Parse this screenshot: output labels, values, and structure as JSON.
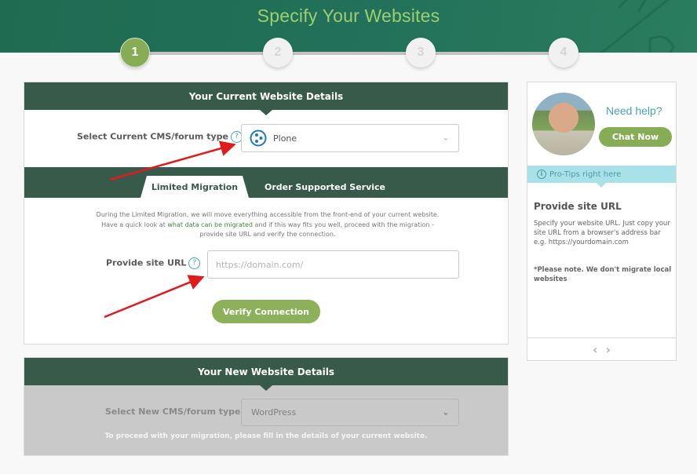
{
  "header": {
    "title": "Specify Your Websites",
    "steps": [
      {
        "label": "1",
        "state": "active"
      },
      {
        "label": "2",
        "state": "inactive"
      },
      {
        "label": "3",
        "state": "inactive"
      },
      {
        "label": "4",
        "state": "inactive"
      }
    ]
  },
  "current": {
    "heading": "Your Current Website Details",
    "cms_label": "Select Current CMS/forum type",
    "help_glyph": "?",
    "cms_value": "Plone",
    "cms_icon": "plone-logo-icon",
    "chevron": "⌄",
    "tabs": [
      {
        "label": "Limited Migration",
        "active": true
      },
      {
        "label": "Order Supported Service",
        "active": false
      }
    ],
    "description_pre": "During the Limited Migration, we will move everything accessible from the front-end of your current website. Have a quick look at ",
    "description_link": "what data can be migrated",
    "description_post": " and if this way fits you well, proceed with the migration - provide site URL and verify the connection.",
    "url_label": "Provide site URL",
    "url_placeholder": "https://domain.com/",
    "url_value": "",
    "verify_label": "Verify Connection"
  },
  "new": {
    "heading": "Your New Website Details",
    "cms_label": "Select New CMS/forum type",
    "cms_value": "WordPress",
    "chevron": "⌄",
    "note": "To proceed with your migration, please fill in the details of your current website."
  },
  "sidebar": {
    "need_help": "Need help?",
    "chat_label": "Chat Now",
    "protips_icon": "i",
    "protips_label": "Pro-Tips right here",
    "tip_title": "Provide site URL",
    "tip_body": "Specify your website URL. Just copy your site URL from a browser's address bar e.g. https://yourdomain.com",
    "tip_note": "*Please note. We don't migrate local websites",
    "prev": "‹",
    "next": "›"
  },
  "colors": {
    "header_green": "#1f6b52",
    "panel_head": "#375a4b",
    "accent_green": "#86ac55",
    "help_teal": "#4aa3b3",
    "protips_bg": "#a9e1e8",
    "annotation_red": "#e01b1b"
  }
}
